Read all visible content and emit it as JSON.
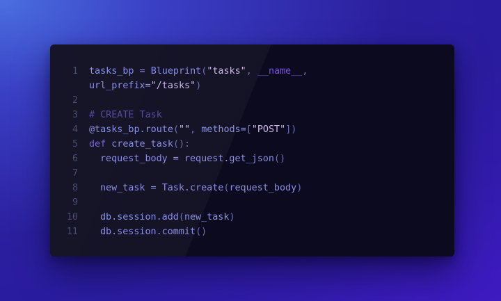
{
  "code_lines": [
    {
      "number": "1",
      "tokens": [
        {
          "t": "tasks_bp",
          "c": "var"
        },
        {
          "t": " = ",
          "c": "op"
        },
        {
          "t": "Blueprint",
          "c": "fn"
        },
        {
          "t": "(",
          "c": "punc"
        },
        {
          "t": "\"tasks\"",
          "c": "str"
        },
        {
          "t": ", ",
          "c": "punc"
        },
        {
          "t": "__name__",
          "c": "builtin"
        },
        {
          "t": ",",
          "c": "punc"
        }
      ]
    },
    {
      "number": "",
      "tokens": [
        {
          "t": "url_prefix",
          "c": "var"
        },
        {
          "t": "=",
          "c": "op"
        },
        {
          "t": "\"/tasks\"",
          "c": "str"
        },
        {
          "t": ")",
          "c": "punc"
        }
      ]
    },
    {
      "number": "2",
      "tokens": []
    },
    {
      "number": "3",
      "tokens": [
        {
          "t": "# CREATE Task",
          "c": "comment"
        }
      ]
    },
    {
      "number": "4",
      "tokens": [
        {
          "t": "@tasks_bp.route",
          "c": "deco"
        },
        {
          "t": "(",
          "c": "punc"
        },
        {
          "t": "\"\"",
          "c": "str"
        },
        {
          "t": ", ",
          "c": "punc"
        },
        {
          "t": "methods",
          "c": "var"
        },
        {
          "t": "=",
          "c": "op"
        },
        {
          "t": "[",
          "c": "punc"
        },
        {
          "t": "\"POST\"",
          "c": "str"
        },
        {
          "t": "])",
          "c": "punc"
        }
      ]
    },
    {
      "number": "5",
      "tokens": [
        {
          "t": "def",
          "c": "kw"
        },
        {
          "t": " ",
          "c": "var"
        },
        {
          "t": "create_task",
          "c": "fn"
        },
        {
          "t": "():",
          "c": "punc"
        }
      ]
    },
    {
      "number": "6",
      "indent": 1,
      "tokens": [
        {
          "t": "request_body",
          "c": "var"
        },
        {
          "t": " = ",
          "c": "op"
        },
        {
          "t": "request.get_json",
          "c": "fn"
        },
        {
          "t": "()",
          "c": "punc"
        }
      ]
    },
    {
      "number": "7",
      "tokens": []
    },
    {
      "number": "8",
      "indent": 1,
      "tokens": [
        {
          "t": "new_task",
          "c": "var"
        },
        {
          "t": " = ",
          "c": "op"
        },
        {
          "t": "Task.create",
          "c": "fn"
        },
        {
          "t": "(",
          "c": "punc"
        },
        {
          "t": "request_body",
          "c": "var"
        },
        {
          "t": ")",
          "c": "punc"
        }
      ]
    },
    {
      "number": "9",
      "tokens": []
    },
    {
      "number": "10",
      "indent": 1,
      "tokens": [
        {
          "t": "db.session.add",
          "c": "fn"
        },
        {
          "t": "(",
          "c": "punc"
        },
        {
          "t": "new_task",
          "c": "var"
        },
        {
          "t": ")",
          "c": "punc"
        }
      ]
    },
    {
      "number": "11",
      "indent": 1,
      "tokens": [
        {
          "t": "db.session.commit",
          "c": "fn"
        },
        {
          "t": "()",
          "c": "punc"
        }
      ]
    }
  ],
  "colors": {
    "background_top_left": "#4a6fe0",
    "background_main": "#2b1f9e",
    "window": "#0c0a1e",
    "line_number": "#4a4d6c",
    "identifier": "#8b8fe6",
    "string": "#cdb9e6",
    "builtin": "#7a52e6",
    "comment": "#5a4b9e",
    "keyword": "#7b63d9"
  }
}
